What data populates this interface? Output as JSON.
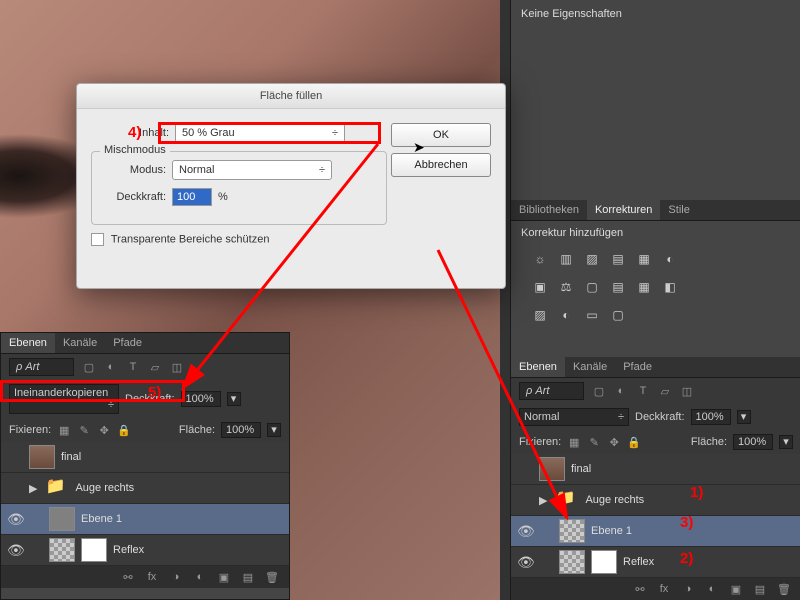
{
  "properties_panel": {
    "no_props": "Keine Eigenschaften"
  },
  "panel_tabs": {
    "bibliotheken": "Bibliotheken",
    "korrekturen": "Korrekturen",
    "stile": "Stile"
  },
  "korrektur_label": "Korrektur hinzufügen",
  "layers_tabs": {
    "ebenen": "Ebenen",
    "kanaele": "Kanäle",
    "pfade": "Pfade"
  },
  "kind_filter": "Art",
  "right_blend": {
    "mode": "Normal",
    "opacity_label": "Deckkraft:",
    "opacity_val": "100%"
  },
  "left_blend": {
    "mode": "Ineinanderkopieren",
    "opacity_label": "Deckkraft:",
    "opacity_val": "100%"
  },
  "fix_row": {
    "label": "Fixieren:",
    "fill_label": "Fläche:",
    "fill_val": "100%"
  },
  "layers": {
    "final": "final",
    "auge_rechts": "Auge rechts",
    "ebene1": "Ebene 1",
    "reflex": "Reflex"
  },
  "dialog": {
    "title": "Fläche füllen",
    "inhalt_label": "Inhalt:",
    "inhalt_value": "50 % Grau",
    "mischmodus": "Mischmodus",
    "modus_label": "Modus:",
    "modus_value": "Normal",
    "deckkraft_label": "Deckkraft:",
    "deckkraft_value": "100",
    "percent": "%",
    "checkbox": "Transparente Bereiche schützen",
    "ok": "OK",
    "cancel": "Abbrechen"
  },
  "annotations": {
    "a1": "1)",
    "a2": "2)",
    "a3": "3)",
    "a4": "4)",
    "a5": "5)"
  }
}
